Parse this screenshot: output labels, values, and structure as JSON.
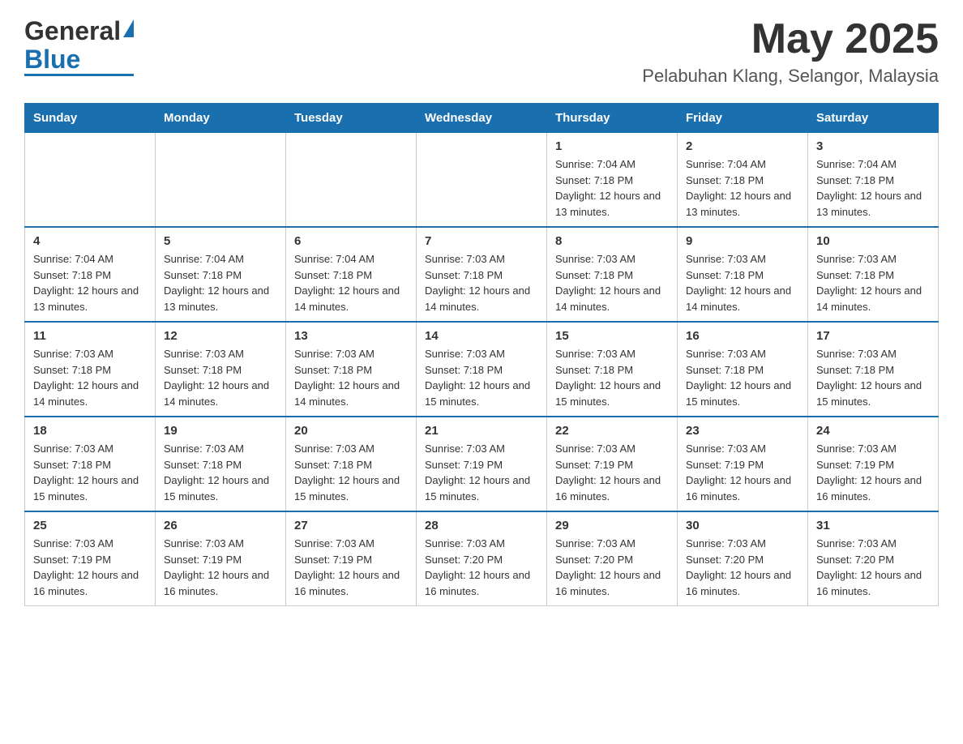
{
  "header": {
    "logo": {
      "general": "General",
      "blue": "Blue",
      "triangle": "▲"
    },
    "title": "May 2025",
    "location": "Pelabuhan Klang, Selangor, Malaysia"
  },
  "calendar": {
    "days_of_week": [
      "Sunday",
      "Monday",
      "Tuesday",
      "Wednesday",
      "Thursday",
      "Friday",
      "Saturday"
    ],
    "weeks": [
      [
        {
          "day": "",
          "sunrise": "",
          "sunset": "",
          "daylight": ""
        },
        {
          "day": "",
          "sunrise": "",
          "sunset": "",
          "daylight": ""
        },
        {
          "day": "",
          "sunrise": "",
          "sunset": "",
          "daylight": ""
        },
        {
          "day": "",
          "sunrise": "",
          "sunset": "",
          "daylight": ""
        },
        {
          "day": "1",
          "sunrise": "Sunrise: 7:04 AM",
          "sunset": "Sunset: 7:18 PM",
          "daylight": "Daylight: 12 hours and 13 minutes."
        },
        {
          "day": "2",
          "sunrise": "Sunrise: 7:04 AM",
          "sunset": "Sunset: 7:18 PM",
          "daylight": "Daylight: 12 hours and 13 minutes."
        },
        {
          "day": "3",
          "sunrise": "Sunrise: 7:04 AM",
          "sunset": "Sunset: 7:18 PM",
          "daylight": "Daylight: 12 hours and 13 minutes."
        }
      ],
      [
        {
          "day": "4",
          "sunrise": "Sunrise: 7:04 AM",
          "sunset": "Sunset: 7:18 PM",
          "daylight": "Daylight: 12 hours and 13 minutes."
        },
        {
          "day": "5",
          "sunrise": "Sunrise: 7:04 AM",
          "sunset": "Sunset: 7:18 PM",
          "daylight": "Daylight: 12 hours and 13 minutes."
        },
        {
          "day": "6",
          "sunrise": "Sunrise: 7:04 AM",
          "sunset": "Sunset: 7:18 PM",
          "daylight": "Daylight: 12 hours and 14 minutes."
        },
        {
          "day": "7",
          "sunrise": "Sunrise: 7:03 AM",
          "sunset": "Sunset: 7:18 PM",
          "daylight": "Daylight: 12 hours and 14 minutes."
        },
        {
          "day": "8",
          "sunrise": "Sunrise: 7:03 AM",
          "sunset": "Sunset: 7:18 PM",
          "daylight": "Daylight: 12 hours and 14 minutes."
        },
        {
          "day": "9",
          "sunrise": "Sunrise: 7:03 AM",
          "sunset": "Sunset: 7:18 PM",
          "daylight": "Daylight: 12 hours and 14 minutes."
        },
        {
          "day": "10",
          "sunrise": "Sunrise: 7:03 AM",
          "sunset": "Sunset: 7:18 PM",
          "daylight": "Daylight: 12 hours and 14 minutes."
        }
      ],
      [
        {
          "day": "11",
          "sunrise": "Sunrise: 7:03 AM",
          "sunset": "Sunset: 7:18 PM",
          "daylight": "Daylight: 12 hours and 14 minutes."
        },
        {
          "day": "12",
          "sunrise": "Sunrise: 7:03 AM",
          "sunset": "Sunset: 7:18 PM",
          "daylight": "Daylight: 12 hours and 14 minutes."
        },
        {
          "day": "13",
          "sunrise": "Sunrise: 7:03 AM",
          "sunset": "Sunset: 7:18 PM",
          "daylight": "Daylight: 12 hours and 14 minutes."
        },
        {
          "day": "14",
          "sunrise": "Sunrise: 7:03 AM",
          "sunset": "Sunset: 7:18 PM",
          "daylight": "Daylight: 12 hours and 15 minutes."
        },
        {
          "day": "15",
          "sunrise": "Sunrise: 7:03 AM",
          "sunset": "Sunset: 7:18 PM",
          "daylight": "Daylight: 12 hours and 15 minutes."
        },
        {
          "day": "16",
          "sunrise": "Sunrise: 7:03 AM",
          "sunset": "Sunset: 7:18 PM",
          "daylight": "Daylight: 12 hours and 15 minutes."
        },
        {
          "day": "17",
          "sunrise": "Sunrise: 7:03 AM",
          "sunset": "Sunset: 7:18 PM",
          "daylight": "Daylight: 12 hours and 15 minutes."
        }
      ],
      [
        {
          "day": "18",
          "sunrise": "Sunrise: 7:03 AM",
          "sunset": "Sunset: 7:18 PM",
          "daylight": "Daylight: 12 hours and 15 minutes."
        },
        {
          "day": "19",
          "sunrise": "Sunrise: 7:03 AM",
          "sunset": "Sunset: 7:18 PM",
          "daylight": "Daylight: 12 hours and 15 minutes."
        },
        {
          "day": "20",
          "sunrise": "Sunrise: 7:03 AM",
          "sunset": "Sunset: 7:18 PM",
          "daylight": "Daylight: 12 hours and 15 minutes."
        },
        {
          "day": "21",
          "sunrise": "Sunrise: 7:03 AM",
          "sunset": "Sunset: 7:19 PM",
          "daylight": "Daylight: 12 hours and 15 minutes."
        },
        {
          "day": "22",
          "sunrise": "Sunrise: 7:03 AM",
          "sunset": "Sunset: 7:19 PM",
          "daylight": "Daylight: 12 hours and 16 minutes."
        },
        {
          "day": "23",
          "sunrise": "Sunrise: 7:03 AM",
          "sunset": "Sunset: 7:19 PM",
          "daylight": "Daylight: 12 hours and 16 minutes."
        },
        {
          "day": "24",
          "sunrise": "Sunrise: 7:03 AM",
          "sunset": "Sunset: 7:19 PM",
          "daylight": "Daylight: 12 hours and 16 minutes."
        }
      ],
      [
        {
          "day": "25",
          "sunrise": "Sunrise: 7:03 AM",
          "sunset": "Sunset: 7:19 PM",
          "daylight": "Daylight: 12 hours and 16 minutes."
        },
        {
          "day": "26",
          "sunrise": "Sunrise: 7:03 AM",
          "sunset": "Sunset: 7:19 PM",
          "daylight": "Daylight: 12 hours and 16 minutes."
        },
        {
          "day": "27",
          "sunrise": "Sunrise: 7:03 AM",
          "sunset": "Sunset: 7:19 PM",
          "daylight": "Daylight: 12 hours and 16 minutes."
        },
        {
          "day": "28",
          "sunrise": "Sunrise: 7:03 AM",
          "sunset": "Sunset: 7:20 PM",
          "daylight": "Daylight: 12 hours and 16 minutes."
        },
        {
          "day": "29",
          "sunrise": "Sunrise: 7:03 AM",
          "sunset": "Sunset: 7:20 PM",
          "daylight": "Daylight: 12 hours and 16 minutes."
        },
        {
          "day": "30",
          "sunrise": "Sunrise: 7:03 AM",
          "sunset": "Sunset: 7:20 PM",
          "daylight": "Daylight: 12 hours and 16 minutes."
        },
        {
          "day": "31",
          "sunrise": "Sunrise: 7:03 AM",
          "sunset": "Sunset: 7:20 PM",
          "daylight": "Daylight: 12 hours and 16 minutes."
        }
      ]
    ]
  }
}
